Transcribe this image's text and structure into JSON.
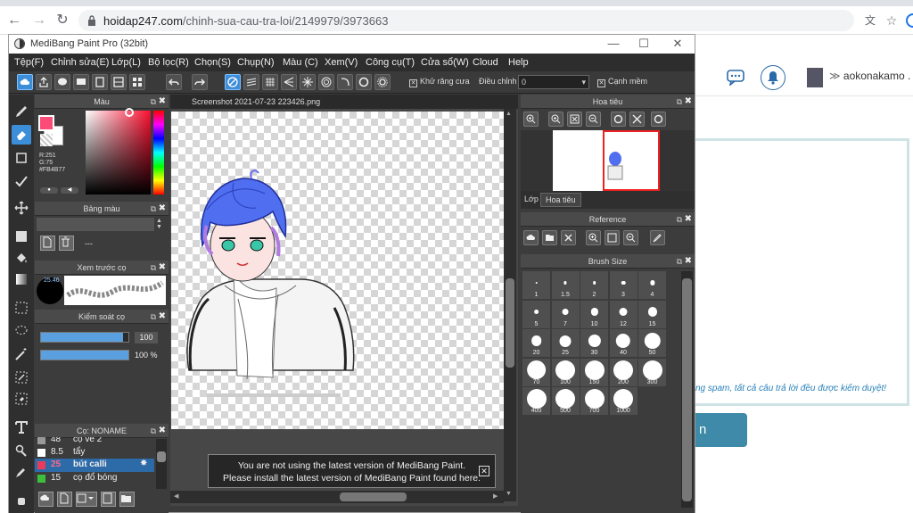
{
  "browser": {
    "url_domain": "hoidap247.com",
    "url_path": "/chinh-sua-cau-tra-loi/2149979/3973663"
  },
  "site": {
    "username": "aokonakamo .",
    "warning": "ng spam, tất cả câu trả lời đều được kiểm duyệt!",
    "button_label": "n"
  },
  "app": {
    "title": "MediBang Paint Pro (32bit)"
  },
  "menu": [
    "Tệp(F)",
    "Chỉnh sửa(E)",
    "Lớp(L)",
    "Bộ lọc(R)",
    "Chọn(S)",
    "Chụp(N)",
    "Màu (C)",
    "Xem(V)",
    "Công cụ(T)",
    "Cửa sổ(W)",
    "Cloud",
    "Help"
  ],
  "toolbar": {
    "antialias": "Khử răng cưa",
    "adjust": "Điều chỉnh",
    "adjust_value": "0",
    "sharp": "Cạnh mềm"
  },
  "color_panel": {
    "title": "Màu",
    "r": "R:251",
    "g": "G:75",
    "hex": "#FB4B77"
  },
  "palette_panel": {
    "title": "Bảng màu",
    "dash": "---"
  },
  "preview_panel": {
    "title": "Xem trước cọ",
    "size": "25.46"
  },
  "brush_control": {
    "title": "Kiểm soát cọ",
    "size_value": "100",
    "opacity_value": "100 %",
    "size_fraction": 0.94,
    "opacity_fraction": 1.0
  },
  "brush_list": {
    "title": "Cọ: NONAME",
    "items": [
      {
        "size": "48",
        "name": "cọ vẽ 2",
        "color": "#999"
      },
      {
        "size": "8.5",
        "name": "tẩy",
        "color": "#fff"
      },
      {
        "size": "25",
        "name": "bút calli",
        "color": "#e83c5a"
      },
      {
        "size": "15",
        "name": "cọ đổ bóng",
        "color": "#3cc03c"
      }
    ]
  },
  "document": {
    "tab": "Screenshot 2021-07-23 223426.png"
  },
  "notice": {
    "line1": "You are not using the latest version of MediBang Paint.",
    "line2": "Please install the latest version of MediBang Paint found here."
  },
  "navigator": {
    "title": "Hoa tiêu",
    "tab_layer": "Lớp",
    "tab_nav": "Hoa tiêu"
  },
  "reference": {
    "title": "Reference"
  },
  "brush_size": {
    "title": "Brush Size",
    "sizes": [
      "1",
      "1.5",
      "2",
      "3",
      "4",
      "5",
      "7",
      "10",
      "12",
      "15",
      "20",
      "25",
      "30",
      "40",
      "50",
      "70",
      "100",
      "150",
      "200",
      "300",
      "400",
      "500",
      "700",
      "1000"
    ]
  }
}
